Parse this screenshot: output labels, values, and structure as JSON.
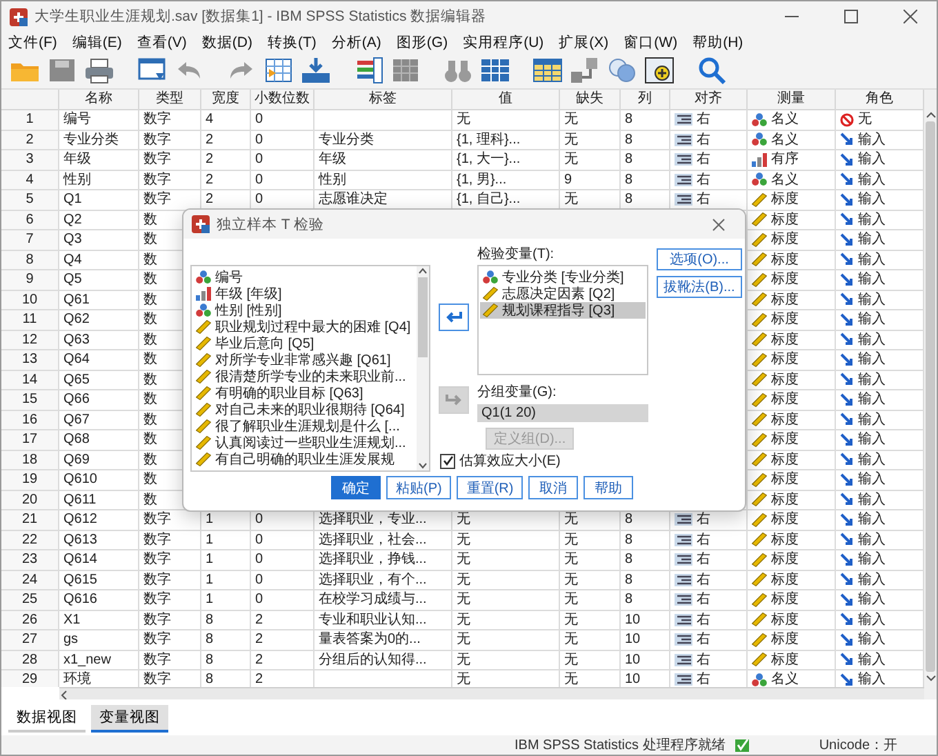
{
  "window": {
    "title": "大学生职业生涯规划.sav [数据集1] - IBM SPSS Statistics 数据编辑器"
  },
  "menu": [
    "文件(F)",
    "编辑(E)",
    "查看(V)",
    "数据(D)",
    "转换(T)",
    "分析(A)",
    "图形(G)",
    "实用程序(U)",
    "扩展(X)",
    "窗口(W)",
    "帮助(H)"
  ],
  "table": {
    "columns": [
      "名称",
      "类型",
      "宽度",
      "小数位数",
      "标签",
      "值",
      "缺失",
      "列",
      "对齐",
      "测量",
      "角色"
    ],
    "rows": [
      {
        "number": "1",
        "name": "编号",
        "type": "数字",
        "length": "4",
        "decimals": "0",
        "value": "无",
        "missing": "无",
        "display_columns": "8",
        "align": "右",
        "measure": {
          "kind": "nominal",
          "text": "名义"
        },
        "role": {
          "kind": "none",
          "text": "无"
        }
      },
      {
        "number": "2",
        "name": "专业分类",
        "type": "数字",
        "length": "2",
        "decimals": "0",
        "label": "专业分类",
        "value": "{1, 理科}...",
        "missing": "无",
        "display_columns": "8",
        "align": "右",
        "measure": {
          "kind": "nominal",
          "text": "名义"
        },
        "role": {
          "kind": "input",
          "text": "输入"
        }
      },
      {
        "number": "3",
        "name": "年级",
        "type": "数字",
        "length": "2",
        "decimals": "0",
        "label": "年级",
        "value": "{1, 大一}...",
        "missing": "无",
        "display_columns": "8",
        "align": "右",
        "measure": {
          "kind": "ordinal",
          "text": "有序"
        },
        "role": {
          "kind": "input",
          "text": "输入"
        }
      },
      {
        "number": "4",
        "name": "性别",
        "type": "数字",
        "length": "2",
        "decimals": "0",
        "label": "性别",
        "value": "{1, 男}...",
        "missing": "9",
        "display_columns": "8",
        "align": "右",
        "measure": {
          "kind": "nominal",
          "text": "名义"
        },
        "role": {
          "kind": "input",
          "text": "输入"
        }
      },
      {
        "number": "5",
        "name": "Q1",
        "type": "数字",
        "length": "2",
        "decimals": "0",
        "label": "志愿谁决定",
        "value": "{1, 自己}...",
        "missing": "无",
        "display_columns": "8",
        "align": "右",
        "measure": {
          "kind": "scale",
          "text": "标度"
        },
        "role": {
          "kind": "input",
          "text": "输入"
        }
      },
      {
        "number": "6",
        "name": "Q2",
        "type": "数",
        "measure": {
          "kind": "scale",
          "text": "标度"
        },
        "role": {
          "kind": "input",
          "text": "输入"
        }
      },
      {
        "number": "7",
        "name": "Q3",
        "type": "数",
        "measure": {
          "kind": "scale",
          "text": "标度"
        },
        "role": {
          "kind": "input",
          "text": "输入"
        }
      },
      {
        "number": "8",
        "name": "Q4",
        "type": "数",
        "measure": {
          "kind": "scale",
          "text": "标度"
        },
        "role": {
          "kind": "input",
          "text": "输入"
        }
      },
      {
        "number": "9",
        "name": "Q5",
        "type": "数",
        "measure": {
          "kind": "scale",
          "text": "标度"
        },
        "role": {
          "kind": "input",
          "text": "输入"
        }
      },
      {
        "number": "10",
        "name": "Q61",
        "type": "数",
        "measure": {
          "kind": "scale",
          "text": "标度"
        },
        "role": {
          "kind": "input",
          "text": "输入"
        }
      },
      {
        "number": "11",
        "name": "Q62",
        "type": "数",
        "measure": {
          "kind": "scale",
          "text": "标度"
        },
        "role": {
          "kind": "input",
          "text": "输入"
        }
      },
      {
        "number": "12",
        "name": "Q63",
        "type": "数",
        "measure": {
          "kind": "scale",
          "text": "标度"
        },
        "role": {
          "kind": "input",
          "text": "输入"
        }
      },
      {
        "number": "13",
        "name": "Q64",
        "type": "数",
        "measure": {
          "kind": "scale",
          "text": "标度"
        },
        "role": {
          "kind": "input",
          "text": "输入"
        }
      },
      {
        "number": "14",
        "name": "Q65",
        "type": "数",
        "measure": {
          "kind": "scale",
          "text": "标度"
        },
        "role": {
          "kind": "input",
          "text": "输入"
        }
      },
      {
        "number": "15",
        "name": "Q66",
        "type": "数",
        "measure": {
          "kind": "scale",
          "text": "标度"
        },
        "role": {
          "kind": "input",
          "text": "输入"
        }
      },
      {
        "number": "16",
        "name": "Q67",
        "type": "数",
        "measure": {
          "kind": "scale",
          "text": "标度"
        },
        "role": {
          "kind": "input",
          "text": "输入"
        }
      },
      {
        "number": "17",
        "name": "Q68",
        "type": "数",
        "measure": {
          "kind": "scale",
          "text": "标度"
        },
        "role": {
          "kind": "input",
          "text": "输入"
        }
      },
      {
        "number": "18",
        "name": "Q69",
        "type": "数",
        "measure": {
          "kind": "scale",
          "text": "标度"
        },
        "role": {
          "kind": "input",
          "text": "输入"
        }
      },
      {
        "number": "19",
        "name": "Q610",
        "type": "数",
        "measure": {
          "kind": "scale",
          "text": "标度"
        },
        "role": {
          "kind": "input",
          "text": "输入"
        }
      },
      {
        "number": "20",
        "name": "Q611",
        "type": "数",
        "measure": {
          "kind": "scale",
          "text": "标度"
        },
        "role": {
          "kind": "input",
          "text": "输入"
        }
      },
      {
        "number": "21",
        "name": "Q612",
        "type": "数字",
        "length": "1",
        "decimals": "0",
        "label": "选择职业，专业...",
        "value": "无",
        "missing": "无",
        "display_columns": "8",
        "align": "右",
        "measure": {
          "kind": "scale",
          "text": "标度"
        },
        "role": {
          "kind": "input",
          "text": "输入"
        }
      },
      {
        "number": "22",
        "name": "Q613",
        "type": "数字",
        "length": "1",
        "decimals": "0",
        "label": "选择职业，社会...",
        "value": "无",
        "missing": "无",
        "display_columns": "8",
        "align": "右",
        "measure": {
          "kind": "scale",
          "text": "标度"
        },
        "role": {
          "kind": "input",
          "text": "输入"
        }
      },
      {
        "number": "23",
        "name": "Q614",
        "type": "数字",
        "length": "1",
        "decimals": "0",
        "label": "选择职业，挣钱...",
        "value": "无",
        "missing": "无",
        "display_columns": "8",
        "align": "右",
        "measure": {
          "kind": "scale",
          "text": "标度"
        },
        "role": {
          "kind": "input",
          "text": "输入"
        }
      },
      {
        "number": "24",
        "name": "Q615",
        "type": "数字",
        "length": "1",
        "decimals": "0",
        "label": "选择职业，有个...",
        "value": "无",
        "missing": "无",
        "display_columns": "8",
        "align": "右",
        "measure": {
          "kind": "scale",
          "text": "标度"
        },
        "role": {
          "kind": "input",
          "text": "输入"
        }
      },
      {
        "number": "25",
        "name": "Q616",
        "type": "数字",
        "length": "1",
        "decimals": "0",
        "label": "在校学习成绩与...",
        "value": "无",
        "missing": "无",
        "display_columns": "8",
        "align": "右",
        "measure": {
          "kind": "scale",
          "text": "标度"
        },
        "role": {
          "kind": "input",
          "text": "输入"
        }
      },
      {
        "number": "26",
        "name": "X1",
        "type": "数字",
        "length": "8",
        "decimals": "2",
        "label": "专业和职业认知...",
        "value": "无",
        "missing": "无",
        "display_columns": "10",
        "align": "右",
        "measure": {
          "kind": "scale",
          "text": "标度"
        },
        "role": {
          "kind": "input",
          "text": "输入"
        }
      },
      {
        "number": "27",
        "name": "gs",
        "type": "数字",
        "length": "8",
        "decimals": "2",
        "label": "量表答案为0的...",
        "value": "无",
        "missing": "无",
        "display_columns": "10",
        "align": "右",
        "measure": {
          "kind": "scale",
          "text": "标度"
        },
        "role": {
          "kind": "input",
          "text": "输入"
        }
      },
      {
        "number": "28",
        "name": "x1_new",
        "type": "数字",
        "length": "8",
        "decimals": "2",
        "label": "分组后的认知得...",
        "value": "无",
        "missing": "无",
        "display_columns": "10",
        "align": "右",
        "measure": {
          "kind": "scale",
          "text": "标度"
        },
        "role": {
          "kind": "input",
          "text": "输入"
        }
      },
      {
        "number": "29",
        "name": "环境",
        "type": "数字",
        "length": "8",
        "decimals": "2",
        "value": "无",
        "missing": "无",
        "display_columns": "10",
        "align": "右",
        "measure": {
          "kind": "nominal",
          "text": "名义"
        },
        "role": {
          "kind": "input",
          "text": "输入"
        }
      }
    ]
  },
  "tabs": [
    {
      "label": "数据视图",
      "selected": false
    },
    {
      "label": "变量视图",
      "selected": true
    }
  ],
  "status_bar": {
    "processor": "IBM SPSS Statistics 处理程序就绪",
    "unicode": "Unicode：开"
  },
  "dialog": {
    "title": "独立样本 T 检验",
    "source_list": [
      {
        "text": "编号",
        "kind": "nominal"
      },
      {
        "text": "年级 [年级]",
        "kind": "ordinal"
      },
      {
        "text": "性别 [性别]",
        "kind": "nominal"
      },
      {
        "text": "职业规划过程中最大的困难 [Q4]",
        "kind": "scale"
      },
      {
        "text": "毕业后意向 [Q5]",
        "kind": "scale"
      },
      {
        "text": "对所学专业非常感兴趣 [Q61]",
        "kind": "scale"
      },
      {
        "text": "很清楚所学专业的未来职业前...",
        "kind": "scale"
      },
      {
        "text": "有明确的职业目标 [Q63]",
        "kind": "scale"
      },
      {
        "text": "对自己未来的职业很期待 [Q64]",
        "kind": "scale"
      },
      {
        "text": "很了解职业生涯规划是什么 [...",
        "kind": "scale"
      },
      {
        "text": "认真阅读过一些职业生涯规划...",
        "kind": "scale"
      },
      {
        "text": "有自己明确的职业生涯发展规",
        "kind": "scale"
      }
    ],
    "arrow_buttons": [
      {
        "disabled": false
      },
      {
        "disabled": true
      }
    ],
    "test_label": "检验变量(T):",
    "test_list": [
      {
        "text": "专业分类 [专业分类]",
        "kind": "nominal",
        "selected": false
      },
      {
        "text": "志愿决定因素 [Q2]",
        "kind": "scale",
        "selected": false
      },
      {
        "text": "规划课程指导 [Q3]",
        "kind": "scale",
        "selected": true
      }
    ],
    "group_label": "分组变量(G):",
    "group_value": "Q1(1 20)",
    "define_groups": {
      "label": "定义组(D)...",
      "disabled": true
    },
    "side_buttons": [
      "选项(O)...",
      "拔靴法(B)..."
    ],
    "effect_size": {
      "label": "估算效应大小(E)",
      "checked": true
    },
    "buttons": [
      {
        "label": "确定",
        "kind": "primary"
      },
      {
        "label": "粘贴(P)",
        "kind": "normal"
      },
      {
        "label": "重置(R)",
        "kind": "normal"
      },
      {
        "label": "取消",
        "kind": "normal"
      },
      {
        "label": "帮助",
        "kind": "normal"
      }
    ]
  }
}
